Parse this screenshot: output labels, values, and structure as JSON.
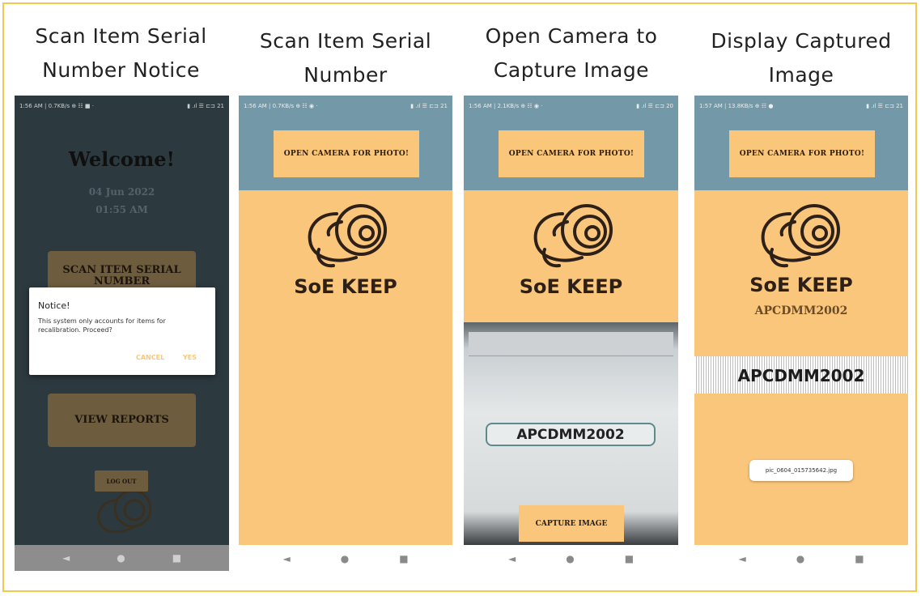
{
  "titles": [
    {
      "line1": "Scan Item Serial",
      "line2": "Number Notice"
    },
    {
      "line1": "Scan Item Serial",
      "line2": "Number"
    },
    {
      "line1": "Open Camera to",
      "line2": "Capture Image"
    },
    {
      "line1": "Display Captured",
      "line2": "Image"
    }
  ],
  "phone1": {
    "status_left": "1:56 AM | 0.7KB/s ⊕ ☷ ■ ·",
    "status_right": "▮ .ıl ☰ ⊏⊐ 21",
    "welcome": "Welcome!",
    "date": "04 Jun 2022",
    "time": "01:55 AM",
    "scan_button": "SCAN ITEM SERIAL NUMBER",
    "reports_button": "VIEW REPORTS",
    "logout_button": "LOG OUT",
    "dialog": {
      "title": "Notice!",
      "message": "This system only accounts for items for recalibration. Proceed?",
      "cancel": "CANCEL",
      "yes": "YES"
    }
  },
  "phone2": {
    "status_left": "1:56 AM | 0.7KB/s ⊕ ☷ ◉ ·",
    "status_right": "▮ .ıl ☰ ⊏⊐ 21",
    "open_camera": "OPEN CAMERA FOR PHOTO!",
    "brand": "SoE KEEP"
  },
  "phone3": {
    "status_left": "1:56 AM | 2.1KB/s ⊕ ☷ ◉ ·",
    "status_right": "▮ .ıl ☰ ⊏⊐ 20",
    "open_camera": "OPEN CAMERA FOR PHOTO!",
    "brand": "SoE KEEP",
    "serial": "APCDMM2002",
    "capture": "CAPTURE IMAGE"
  },
  "phone4": {
    "status_left": "1:57 AM | 13.8KB/s ⊕ ☷ ●",
    "status_right": "▮ .ıl ☰ ⊏⊐ 21",
    "open_camera": "OPEN CAMERA FOR PHOTO!",
    "brand": "SoE KEEP",
    "serial_label": "APCDMM2002",
    "serial_image_text": "APCDMM2002",
    "toast": "pic_0604_015735642.jpg"
  },
  "nav": {
    "back": "◄",
    "home": "●",
    "recents": "■"
  },
  "colors": {
    "border": "#f2c94c",
    "peach": "#fac67b",
    "slate": "#7398a7",
    "dark_bg": "#2c3a40",
    "brown_button": "#6e5c3e"
  },
  "icons": [
    "ram-logo-icon",
    "back-nav-icon",
    "home-nav-icon",
    "recents-nav-icon"
  ]
}
